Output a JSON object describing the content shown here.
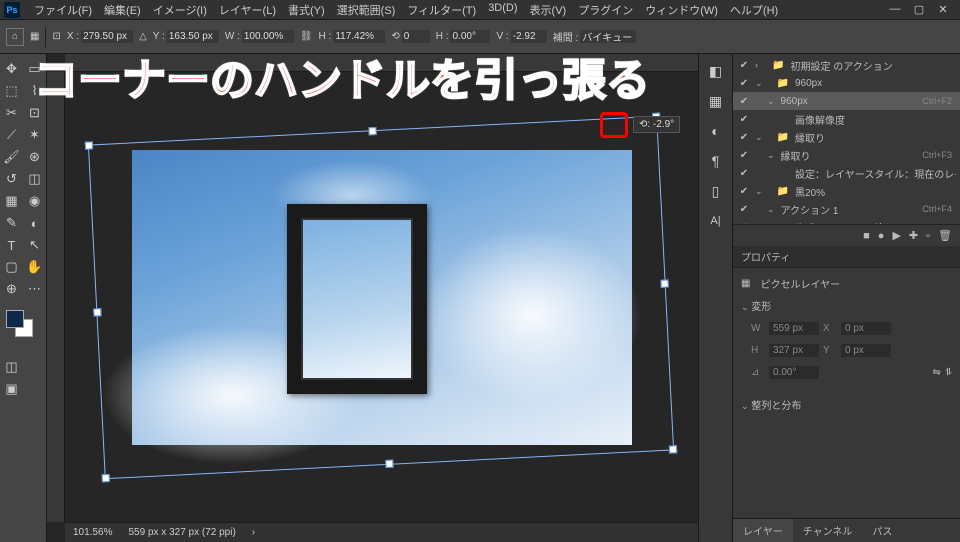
{
  "menu": {
    "items": [
      "ファイル(F)",
      "編集(E)",
      "イメージ(I)",
      "レイヤー(L)",
      "書式(Y)",
      "選択範囲(S)",
      "フィルター(T)",
      "3D(D)",
      "表示(V)",
      "プラグイン",
      "ウィンドウ(W)",
      "ヘルプ(H)"
    ]
  },
  "opt": {
    "x_lbl": "X :",
    "x": "279.50 px",
    "y_lbl": "Y :",
    "y": "163.50 px",
    "w_lbl": "W :",
    "w": "100.00%",
    "h_lbl": "H :",
    "h": "117.42%",
    "rot_lbl": "⟲",
    "rot": "0",
    "sh_lbl": "H :",
    "sh": "0.00°",
    "v_lbl": "V :",
    "v": "-2.92",
    "interp_lbl": "補間 :",
    "interp": "バイキュービ"
  },
  "angle_tip": "⟲: -2.9°",
  "actions": {
    "items": [
      {
        "lbl": "初期設定 のアクション",
        "ind": 1,
        "fold": true,
        "sc": ""
      },
      {
        "lbl": "960px",
        "ind": 1,
        "fold": true,
        "open": true,
        "sc": ""
      },
      {
        "lbl": "960px",
        "ind": 2,
        "open": true,
        "sc": "Ctrl+F2",
        "sel": true
      },
      {
        "lbl": "画像解像度",
        "ind": 3,
        "sc": ""
      },
      {
        "lbl": "縁取り",
        "ind": 1,
        "fold": true,
        "open": true,
        "sc": ""
      },
      {
        "lbl": "縁取り",
        "ind": 2,
        "open": true,
        "sc": "Ctrl+F3"
      },
      {
        "lbl": "設定：レイヤースタイル：現在のレイ...",
        "ind": 3,
        "sc": ""
      },
      {
        "lbl": "黒20%",
        "ind": 1,
        "fold": true,
        "open": true,
        "sc": ""
      },
      {
        "lbl": "アクション 1",
        "ind": 2,
        "open": true,
        "sc": "Ctrl+F4"
      },
      {
        "lbl": "作成：レイヤーの塗りつぶし",
        "ind": 3,
        "sc": ""
      }
    ]
  },
  "props": {
    "title": "プロパティ",
    "layer_type": "ピクセルレイヤー",
    "transform": "変形",
    "w_lbl": "W",
    "w": "559 px",
    "x_lbl": "X",
    "x": "0 px",
    "h_lbl": "H",
    "h": "327 px",
    "y_lbl": "Y",
    "y": "0 px",
    "ang_lbl": "⊿",
    "ang": "0.00°",
    "align": "整列と分布"
  },
  "status": {
    "zoom": "101.56%",
    "dims": "559 px x 327 px (72 ppi)"
  },
  "tabs": {
    "items": [
      "レイヤー",
      "チャンネル",
      "パス"
    ]
  },
  "annotation": "コーナーのハンドルを引っ張る"
}
